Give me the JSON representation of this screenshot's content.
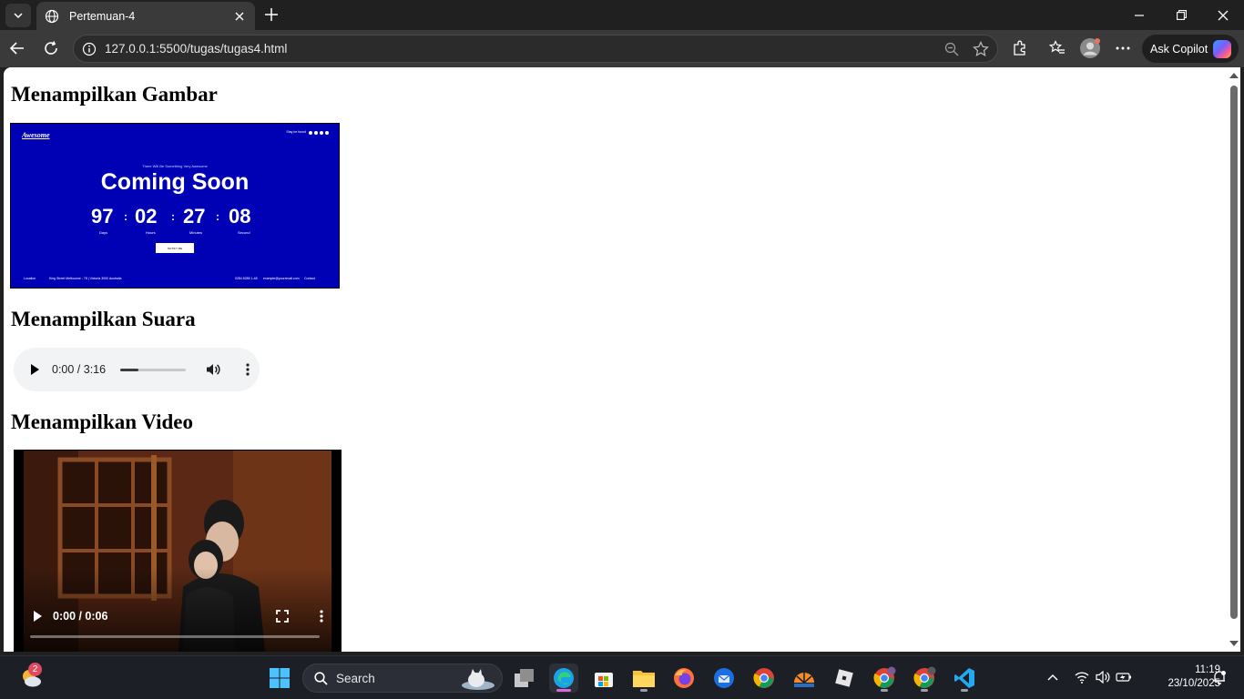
{
  "browser": {
    "tab_title": "Pertemuan-4",
    "url": "127.0.0.1:5500/tugas/tugas4.html",
    "copilot_label": "Ask Copilot"
  },
  "page": {
    "heading_image": "Menampilkan Gambar",
    "heading_audio": "Menampilkan Suara",
    "heading_video": "Menampilkan Video"
  },
  "image_content": {
    "brand": "Awesome",
    "top_link": "Stay be found",
    "tagline": "There Will Be Something Very Awesome",
    "title": "Coming Soon",
    "days": "97",
    "hours": "02",
    "minutes": "27",
    "seconds": "08",
    "days_label": "Days",
    "hours_label": "Hours",
    "minutes_label": "Minutes",
    "seconds_label": "Second",
    "notify": "NOTIFY ME",
    "footer_location": "Location",
    "footer_address": "King Street Melbourne - 78  |  Victoria 3000 Australia",
    "footer_phone": "0284 8285 1-48",
    "footer_email": "example@youremail.com",
    "footer_contact": "Contact"
  },
  "audio": {
    "time": "0:00 / 3:16",
    "buffered_fraction": 0.28
  },
  "video": {
    "time": "0:00 / 0:06"
  },
  "taskbar": {
    "search_label": "Search",
    "time": "11:19",
    "date": "23/10/2025",
    "weather_badge": "2"
  }
}
